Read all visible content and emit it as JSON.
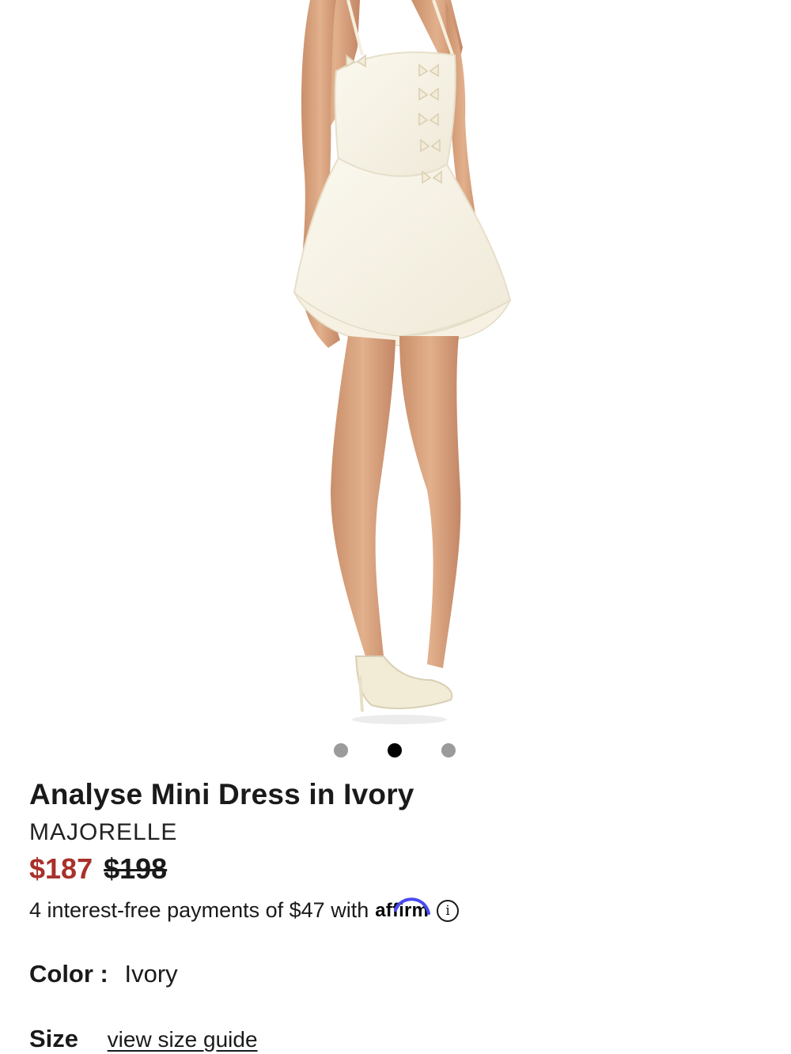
{
  "product": {
    "title": "Analyse Mini Dress in Ivory",
    "brand": "MAJORELLE",
    "price_sale": "$187",
    "price_original": "$198",
    "installments_text": "4 interest-free payments of $47 with",
    "affirm_label": "affirm",
    "info_icon_glyph": "i",
    "color_label": "Color :",
    "color_value": "Ivory",
    "size_label": "Size",
    "size_guide_link": "view size guide"
  },
  "carousel": {
    "total_dots": 3,
    "active_index": 1
  },
  "icons": {
    "info": "info-icon",
    "affirm": "affirm-logo-icon"
  },
  "colors": {
    "sale_price": "#a8312a",
    "active_dot": "#000000",
    "inactive_dot": "#9b9b9b",
    "affirm_arc": "#4a4af4"
  }
}
